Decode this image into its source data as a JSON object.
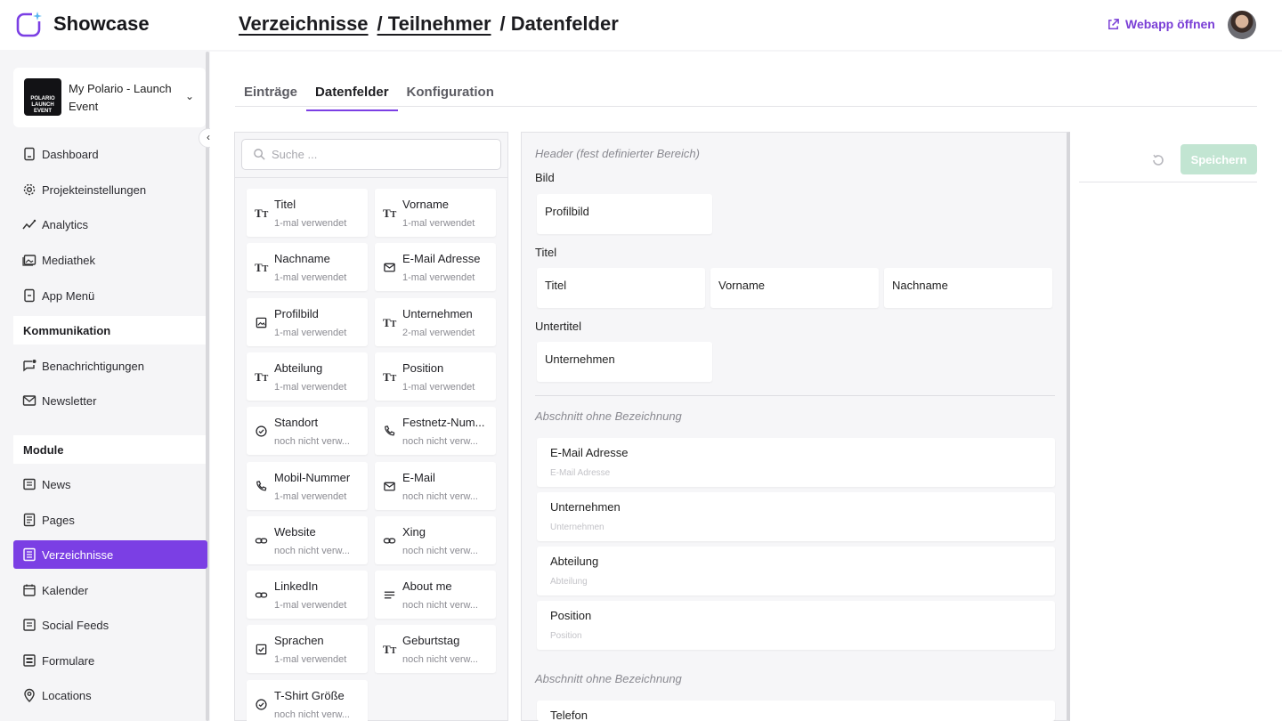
{
  "app": {
    "brand": "Showcase"
  },
  "breadcrumb": [
    {
      "label": "Verzeichnisse",
      "link": true
    },
    {
      "label": "/ Teilnehmer",
      "link": true
    },
    {
      "label": "/ Datenfelder",
      "link": false
    }
  ],
  "header": {
    "webapp_label": "Webapp öffnen",
    "accent_color": "#7b3fe4"
  },
  "project": {
    "name": "My Polario - Launch Event",
    "thumb_text": "POLARIO LAUNCH EVENT"
  },
  "sidebar": {
    "items": [
      {
        "label": "Dashboard",
        "icon": "dashboard-icon"
      },
      {
        "label": "Projekteinstellungen",
        "icon": "gear-icon"
      },
      {
        "label": "Analytics",
        "icon": "analytics-icon"
      },
      {
        "label": "Mediathek",
        "icon": "media-icon"
      },
      {
        "label": "App Menü",
        "icon": "menu-icon"
      }
    ],
    "section_kommunikation": "Kommunikation",
    "kommunikation_items": [
      {
        "label": "Benachrichtigungen",
        "icon": "notification-icon"
      },
      {
        "label": "Newsletter",
        "icon": "mail-icon"
      }
    ],
    "section_module": "Module",
    "module_items": [
      {
        "label": "News",
        "icon": "news-icon"
      },
      {
        "label": "Pages",
        "icon": "pages-icon"
      },
      {
        "label": "Verzeichnisse",
        "icon": "directory-icon",
        "active": true
      },
      {
        "label": "Kalender",
        "icon": "calendar-icon"
      },
      {
        "label": "Social Feeds",
        "icon": "social-icon"
      },
      {
        "label": "Formulare",
        "icon": "form-icon"
      },
      {
        "label": "Locations",
        "icon": "location-icon"
      }
    ]
  },
  "tabs": [
    {
      "label": "Einträge",
      "active": false
    },
    {
      "label": "Datenfelder",
      "active": true
    },
    {
      "label": "Konfiguration",
      "active": false
    }
  ],
  "search": {
    "placeholder": "Suche ..."
  },
  "fields": [
    {
      "name": "Titel",
      "usage": "1-mal verwendet",
      "icon": "text-icon"
    },
    {
      "name": "Vorname",
      "usage": "1-mal verwendet",
      "icon": "text-icon"
    },
    {
      "name": "Nachname",
      "usage": "1-mal verwendet",
      "icon": "text-icon"
    },
    {
      "name": "E-Mail Adresse",
      "usage": "1-mal verwendet",
      "icon": "mail-icon"
    },
    {
      "name": "Profilbild",
      "usage": "1-mal verwendet",
      "icon": "image-icon"
    },
    {
      "name": "Unternehmen",
      "usage": "2-mal verwendet",
      "icon": "text-icon"
    },
    {
      "name": "Abteilung",
      "usage": "1-mal verwendet",
      "icon": "text-icon"
    },
    {
      "name": "Position",
      "usage": "1-mal verwendet",
      "icon": "text-icon"
    },
    {
      "name": "Standort",
      "usage": "noch nicht verw...",
      "icon": "check-circle-icon"
    },
    {
      "name": "Festnetz-Num...",
      "usage": "noch nicht verw...",
      "icon": "phone-icon"
    },
    {
      "name": "Mobil-Nummer",
      "usage": "1-mal verwendet",
      "icon": "phone-icon"
    },
    {
      "name": "E-Mail",
      "usage": "noch nicht verw...",
      "icon": "mail-icon"
    },
    {
      "name": "Website",
      "usage": "noch nicht verw...",
      "icon": "link-icon"
    },
    {
      "name": "Xing",
      "usage": "noch nicht verw...",
      "icon": "link-icon"
    },
    {
      "name": "LinkedIn",
      "usage": "1-mal verwendet",
      "icon": "link-icon"
    },
    {
      "name": "About me",
      "usage": "noch nicht verw...",
      "icon": "lines-icon"
    },
    {
      "name": "Sprachen",
      "usage": "1-mal verwendet",
      "icon": "checkbox-icon"
    },
    {
      "name": "Geburtstag",
      "usage": "noch nicht verw...",
      "icon": "text-icon"
    },
    {
      "name": "T-Shirt Größe",
      "usage": "noch nicht verw...",
      "icon": "check-circle-icon"
    }
  ],
  "layout": {
    "header_title": "Header (fest definierter Bereich)",
    "bild_label": "Bild",
    "bild_slot": "Profilbild",
    "titel_label": "Titel",
    "titel_slots": [
      "Titel",
      "Vorname",
      "Nachname"
    ],
    "untertitel_label": "Untertitel",
    "untertitel_slot": "Unternehmen",
    "section1_title": "Abschnitt ohne Bezeichnung",
    "section1_rows": [
      {
        "title": "E-Mail Adresse",
        "placeholder": "E-Mail Adresse"
      },
      {
        "title": "Unternehmen",
        "placeholder": "Unternehmen"
      },
      {
        "title": "Abteilung",
        "placeholder": "Abteilung"
      },
      {
        "title": "Position",
        "placeholder": "Position"
      }
    ],
    "section2_title": "Abschnitt ohne Bezeichnung",
    "section2_rows": [
      {
        "title": "Telefon"
      }
    ]
  },
  "actions": {
    "save_label": "Speichern"
  }
}
